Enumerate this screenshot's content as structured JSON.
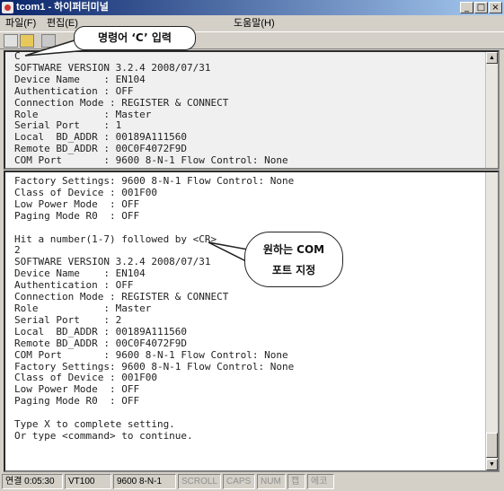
{
  "window": {
    "title": "tcom1 - 하이퍼터미널"
  },
  "menu": [
    "파일(F)",
    "편집(E)",
    "도움말(H)"
  ],
  "top_terminal_lines": [
    "C",
    "SOFTWARE VERSION 3.2.4 2008/07/31",
    "Device Name    : EN104",
    "Authentication : OFF",
    "Connection Mode : REGISTER & CONNECT",
    "Role           : Master",
    "Serial Port    : 1",
    "Local  BD_ADDR : 00189A111560",
    "Remote BD_ADDR : 00C0F4072F9D",
    "COM Port       : 9600 8-N-1 Flow Control: None"
  ],
  "bottom_terminal_lines": [
    "Factory Settings: 9600 8-N-1 Flow Control: None",
    "Class of Device : 001F00",
    "Low Power Mode  : OFF",
    "Paging Mode R0  : OFF",
    "",
    "Hit a number(1-7) followed by <CR>",
    "2",
    "SOFTWARE VERSION 3.2.4 2008/07/31",
    "Device Name    : EN104",
    "Authentication : OFF",
    "Connection Mode : REGISTER & CONNECT",
    "Role           : Master",
    "Serial Port    : 2",
    "Local  BD_ADDR : 00189A111560",
    "Remote BD_ADDR : 00C0F4072F9D",
    "COM Port       : 9600 8-N-1 Flow Control: None",
    "Factory Settings: 9600 8-N-1 Flow Control: None",
    "Class of Device : 001F00",
    "Low Power Mode  : OFF",
    "Paging Mode R0  : OFF",
    "",
    "Type X to complete setting.",
    "Or type <command> to continue."
  ],
  "callouts": {
    "command_input": "명령어 ‘C’ 입력",
    "com_line1": "원하는 COM",
    "com_line2": "포트 지정"
  },
  "status": {
    "connected": "연결 0:05:30",
    "emulation": "VT100",
    "port_settings": "9600 8-N-1",
    "scroll": "SCROLL",
    "caps": "CAPS",
    "num": "NUM",
    "capture": "캡",
    "echo": "에코"
  },
  "icons": {
    "app": "hyperterminal-icon",
    "new": "new-document-icon",
    "open": "open-folder-icon",
    "dial": "phone-icon"
  }
}
